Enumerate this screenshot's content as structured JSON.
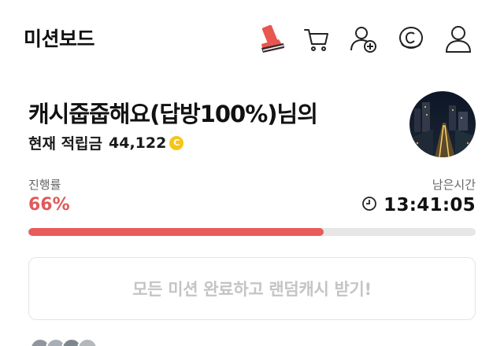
{
  "header": {
    "title": "미션보드",
    "icons": [
      "sneaker-icon",
      "cart-icon",
      "add-friend-icon",
      "coin-c-icon",
      "profile-icon"
    ]
  },
  "profile": {
    "name": "캐시줍줍해요(답방100%)님의",
    "points_label": "현재 적립금",
    "points_value": "44,122",
    "coin_symbol": "C"
  },
  "progress": {
    "label": "진행률",
    "value_text": "66%",
    "fraction": 0.66,
    "remaining_label": "남은시간",
    "remaining_time": "13:41:05"
  },
  "cta": {
    "label": "모든 미션 완료하고 랜덤캐시 받기!"
  },
  "colors": {
    "accent": "#e85b5b",
    "coin": "#f5c518",
    "cta_text": "#c4c4c4"
  }
}
